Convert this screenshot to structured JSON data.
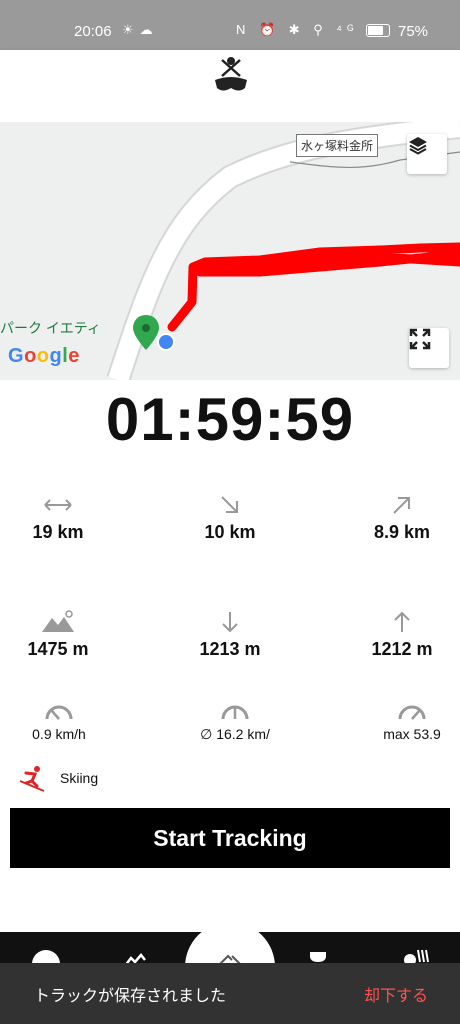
{
  "status_bar": {
    "time": "20:06",
    "left_icons": "☀☁",
    "right_icons": "N ⏰ ✱ ⚲ ⁴ᴳ",
    "battery": "75%"
  },
  "map": {
    "place_label": "水ヶ塚料金所",
    "place_name": "パーク イエティ",
    "google": [
      {
        "ch": "G",
        "color": "#4285F4"
      },
      {
        "ch": "o",
        "color": "#EA4335"
      },
      {
        "ch": "o",
        "color": "#FBBC05"
      },
      {
        "ch": "g",
        "color": "#4285F4"
      },
      {
        "ch": "l",
        "color": "#34A853"
      },
      {
        "ch": "e",
        "color": "#EA4335"
      }
    ],
    "track_color": "#ff0000",
    "layers_icon": "layers-icon",
    "fullscreen_icon": "fullscreen-icon"
  },
  "timer": "01:59:59",
  "stats": {
    "distance": "19 km",
    "downhill_distance": "10 km",
    "uphill_distance": "8.9 km",
    "max_altitude": "1475 m",
    "descent": "1213 m",
    "ascent": "1212 m"
  },
  "speed": {
    "current": "0.9 km/h",
    "average": "∅ 16.2 km/",
    "max": "max 53.9"
  },
  "activity": {
    "label": "Skiing",
    "icon": "skier-icon"
  },
  "start_button": {
    "label": "Start Tracking"
  },
  "snackbar": {
    "message": "トラックが保存されました",
    "action": "却下する"
  }
}
